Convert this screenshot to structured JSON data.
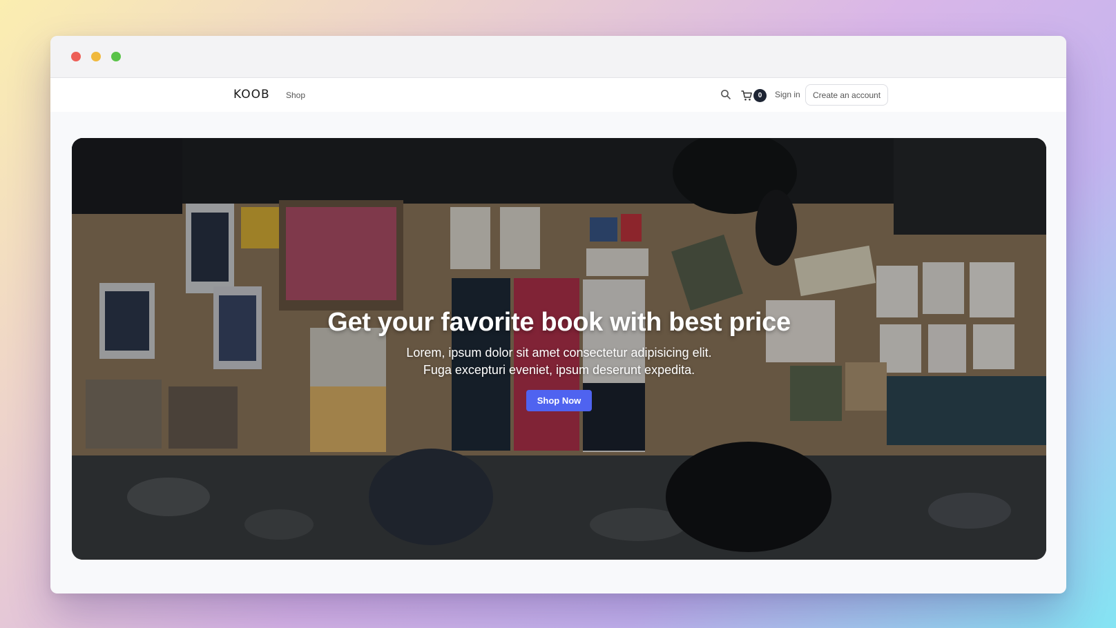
{
  "window": {
    "controls": [
      "close",
      "minimize",
      "maximize"
    ]
  },
  "navbar": {
    "logo": "KOOB",
    "links": [
      {
        "label": "Shop"
      }
    ],
    "search_icon": "search-icon",
    "cart_icon": "cart-icon",
    "cart_count": "0",
    "signin_label": "Sign in",
    "create_account_label": "Create an account"
  },
  "hero": {
    "title": "Get your favorite book with best price",
    "subtitle_line1": "Lorem, ipsum dolor sit amet consectetur adipisicing elit.",
    "subtitle_line2": "Fuga excepturi eveniet, ipsum deserunt expedita.",
    "cta_label": "Shop Now",
    "image": "overhead view of a table covered with books, notebooks and hand-lettered prints"
  },
  "colors": {
    "accent": "#4f63f0",
    "cart_badge": "#1d2433",
    "close": "#ed5f57",
    "minimize": "#f0b93e",
    "maximize": "#5ac349"
  }
}
